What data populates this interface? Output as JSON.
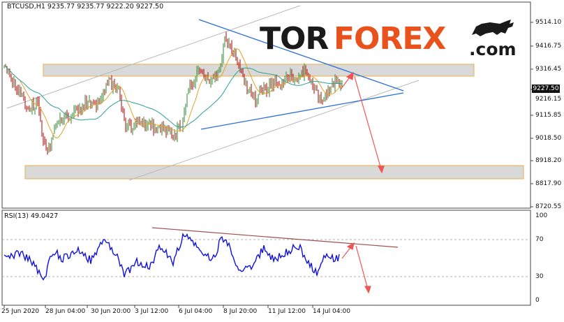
{
  "main_chart": {
    "symbol_header": "BTCUSD,H1  9235.77 9235.77 9222.20 9227.50",
    "current_price": "9227.50",
    "price_labels": [
      "9514.10",
      "9416.75",
      "9316.45",
      "9216.15",
      "9115.85",
      "9018.50",
      "8918.20",
      "8817.90",
      "8720.55"
    ]
  },
  "rsi_panel": {
    "header": "RSI(13) 49.0427",
    "levels": [
      "100",
      "70",
      "30",
      "0"
    ]
  },
  "time_axis": [
    "25 Jun 2020",
    "28 Jun 04:00",
    "30 Jun 20:00",
    "3 Jul 12:00",
    "6 Jul 04:00",
    "8 Jul 20:00",
    "11 Jul 12:00",
    "14 Jul 04:00"
  ],
  "watermark": {
    "part1": "TOR",
    "part2": "FOREX",
    "part3": ".com"
  },
  "colors": {
    "bull_candle": "#2d8a2d",
    "bear_candle": "#b00000",
    "ma_fast": "#e5a02a",
    "ma_slow": "#2aa198",
    "trendline": "#2a6fd6",
    "forecast_arrow": "#ee5555",
    "zone_fill": "#d9d9d9",
    "zone_border": "#e8b04a",
    "rsi_line": "#1010e0",
    "rsi_trend": "#a05050",
    "logo_accent": "#e8531d"
  }
}
